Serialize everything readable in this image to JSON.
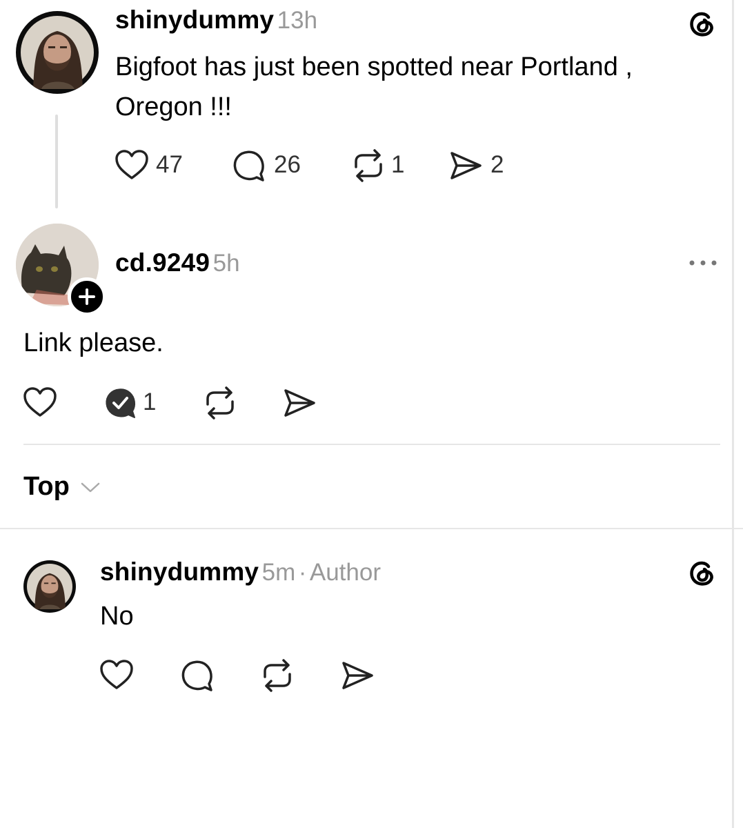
{
  "original_post": {
    "username": "shinydummy",
    "time": "13h",
    "text": "Bigfoot has just been spotted near Portland , Oregon !!!",
    "likes": "47",
    "replies": "26",
    "reposts": "1",
    "shares": "2"
  },
  "reply_post": {
    "username": "cd.9249",
    "time": "5h",
    "text": "Link please.",
    "replies": "1"
  },
  "sort": {
    "label": "Top"
  },
  "comment": {
    "username": "shinydummy",
    "time": "5m",
    "separator": "·",
    "badge": "Author",
    "text": "No"
  },
  "colors": {
    "text": "#000000",
    "meta": "#999999",
    "divider": "#e6e6e6"
  }
}
